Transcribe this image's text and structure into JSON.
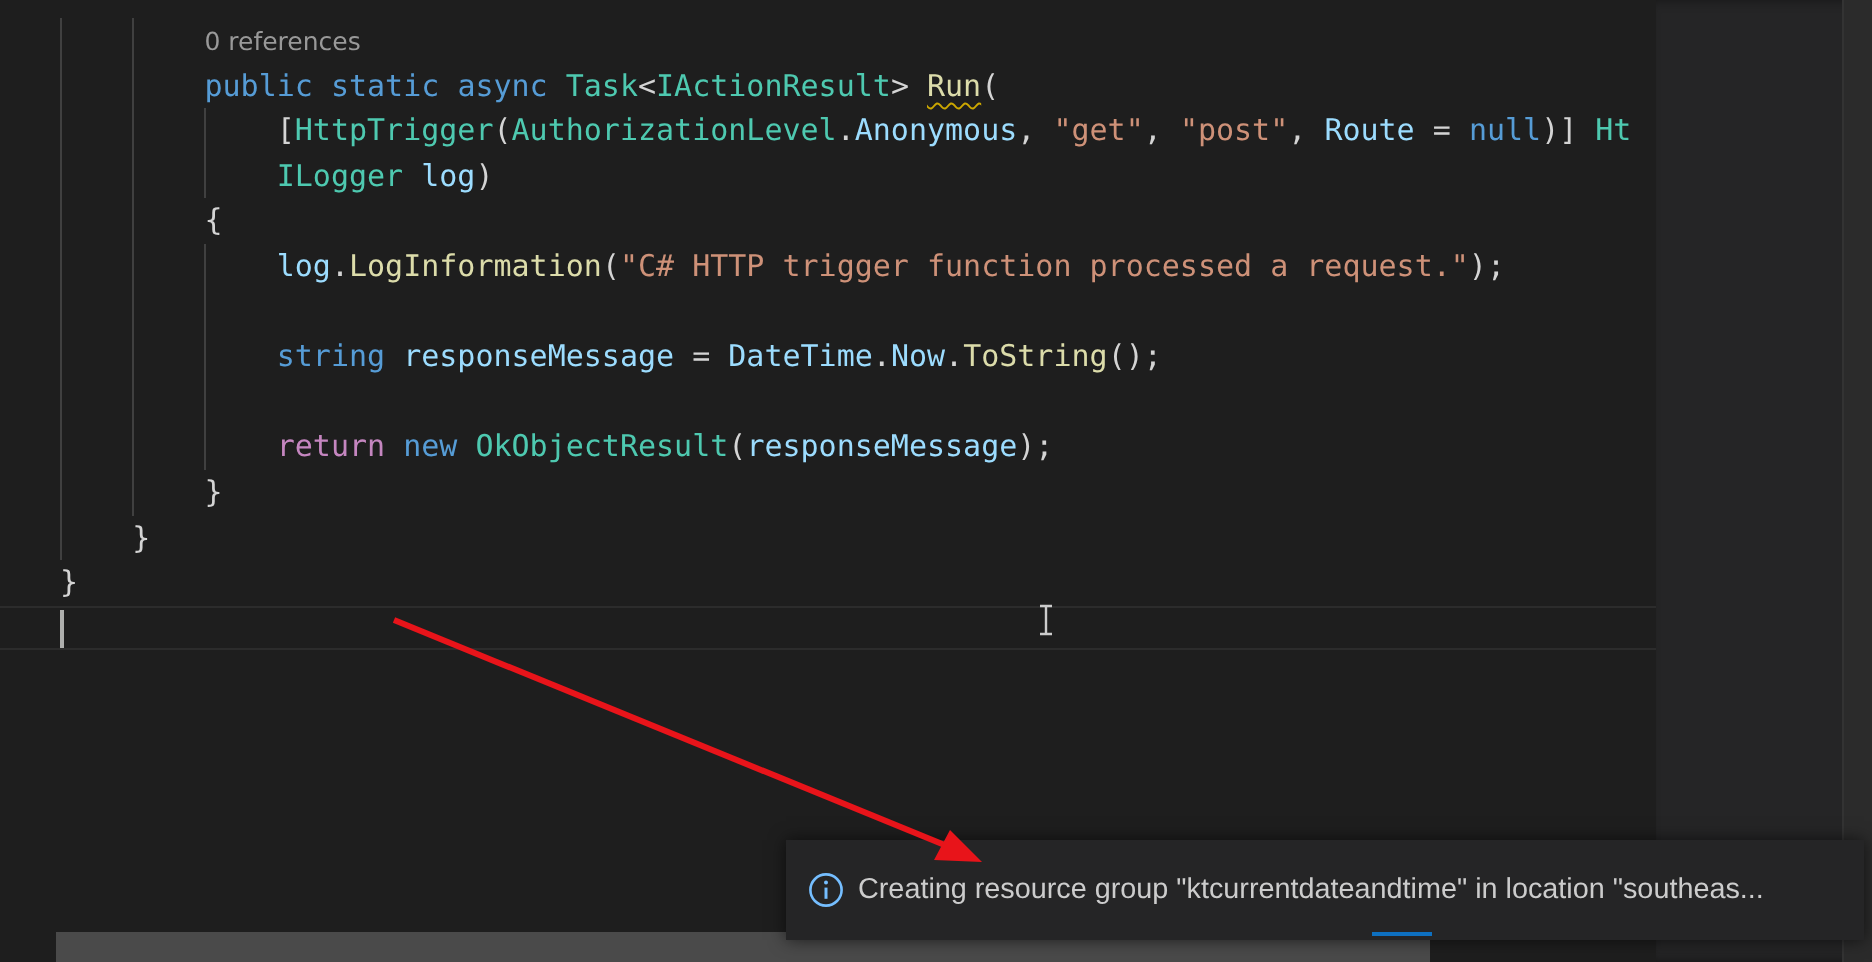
{
  "editor": {
    "lines": [
      {
        "kind": "codelens",
        "text": "0 references"
      },
      {
        "kind": "code",
        "tokens": [
          {
            "text": "        public ",
            "kind": "kw"
          },
          {
            "text": "static ",
            "kind": "kw"
          },
          {
            "text": "async ",
            "kind": "kw"
          },
          {
            "text": "Task",
            "kind": "type"
          },
          {
            "text": "<",
            "kind": "plain"
          },
          {
            "text": "IActionResult",
            "kind": "type"
          },
          {
            "text": "> ",
            "kind": "plain"
          },
          {
            "text": "Run",
            "kind": "fn",
            "warning": true
          },
          {
            "text": "(",
            "kind": "plain"
          }
        ]
      },
      {
        "kind": "code",
        "tokens": [
          {
            "text": "            [",
            "kind": "plain"
          },
          {
            "text": "HttpTrigger",
            "kind": "type"
          },
          {
            "text": "(",
            "kind": "plain"
          },
          {
            "text": "AuthorizationLevel",
            "kind": "type"
          },
          {
            "text": ".",
            "kind": "plain"
          },
          {
            "text": "Anonymous",
            "kind": "var"
          },
          {
            "text": ", ",
            "kind": "plain"
          },
          {
            "text": "\"get\"",
            "kind": "str"
          },
          {
            "text": ", ",
            "kind": "plain"
          },
          {
            "text": "\"post\"",
            "kind": "str"
          },
          {
            "text": ", ",
            "kind": "plain"
          },
          {
            "text": "Route ",
            "kind": "var"
          },
          {
            "text": "= ",
            "kind": "plain"
          },
          {
            "text": "null",
            "kind": "kw"
          },
          {
            "text": ")] ",
            "kind": "plain"
          },
          {
            "text": "Ht",
            "kind": "type"
          }
        ]
      },
      {
        "kind": "code",
        "tokens": [
          {
            "text": "            ILogger ",
            "kind": "type"
          },
          {
            "text": "log",
            "kind": "var"
          },
          {
            "text": ")",
            "kind": "plain"
          }
        ]
      },
      {
        "kind": "code",
        "tokens": [
          {
            "text": "        {",
            "kind": "plain"
          }
        ]
      },
      {
        "kind": "code",
        "tokens": [
          {
            "text": "            log",
            "kind": "var"
          },
          {
            "text": ".",
            "kind": "plain"
          },
          {
            "text": "LogInformation",
            "kind": "fn"
          },
          {
            "text": "(",
            "kind": "plain"
          },
          {
            "text": "\"C# HTTP trigger function processed a request.\"",
            "kind": "str"
          },
          {
            "text": ");",
            "kind": "plain"
          }
        ]
      },
      {
        "kind": "blank"
      },
      {
        "kind": "code",
        "tokens": [
          {
            "text": "            string ",
            "kind": "kw"
          },
          {
            "text": "responseMessage ",
            "kind": "var"
          },
          {
            "text": "= ",
            "kind": "plain"
          },
          {
            "text": "DateTime",
            "kind": "var"
          },
          {
            "text": ".",
            "kind": "plain"
          },
          {
            "text": "Now",
            "kind": "var"
          },
          {
            "text": ".",
            "kind": "plain"
          },
          {
            "text": "ToString",
            "kind": "fn"
          },
          {
            "text": "();",
            "kind": "plain"
          }
        ]
      },
      {
        "kind": "blank"
      },
      {
        "kind": "code",
        "tokens": [
          {
            "text": "            return ",
            "kind": "ctrl"
          },
          {
            "text": "new ",
            "kind": "kw"
          },
          {
            "text": "OkObjectResult",
            "kind": "type"
          },
          {
            "text": "(",
            "kind": "plain"
          },
          {
            "text": "responseMessage",
            "kind": "var"
          },
          {
            "text": ");",
            "kind": "plain"
          }
        ]
      },
      {
        "kind": "code",
        "tokens": [
          {
            "text": "        }",
            "kind": "plain"
          }
        ]
      },
      {
        "kind": "code",
        "tokens": [
          {
            "text": "    }",
            "kind": "plain"
          }
        ]
      },
      {
        "kind": "code",
        "tokens": [
          {
            "text": "}",
            "kind": "plain"
          }
        ]
      },
      {
        "kind": "code",
        "current": true
      }
    ]
  },
  "notification": {
    "message": "Creating resource group \"ktcurrentdateandtime\" in location \"southeas...",
    "progress": true
  }
}
